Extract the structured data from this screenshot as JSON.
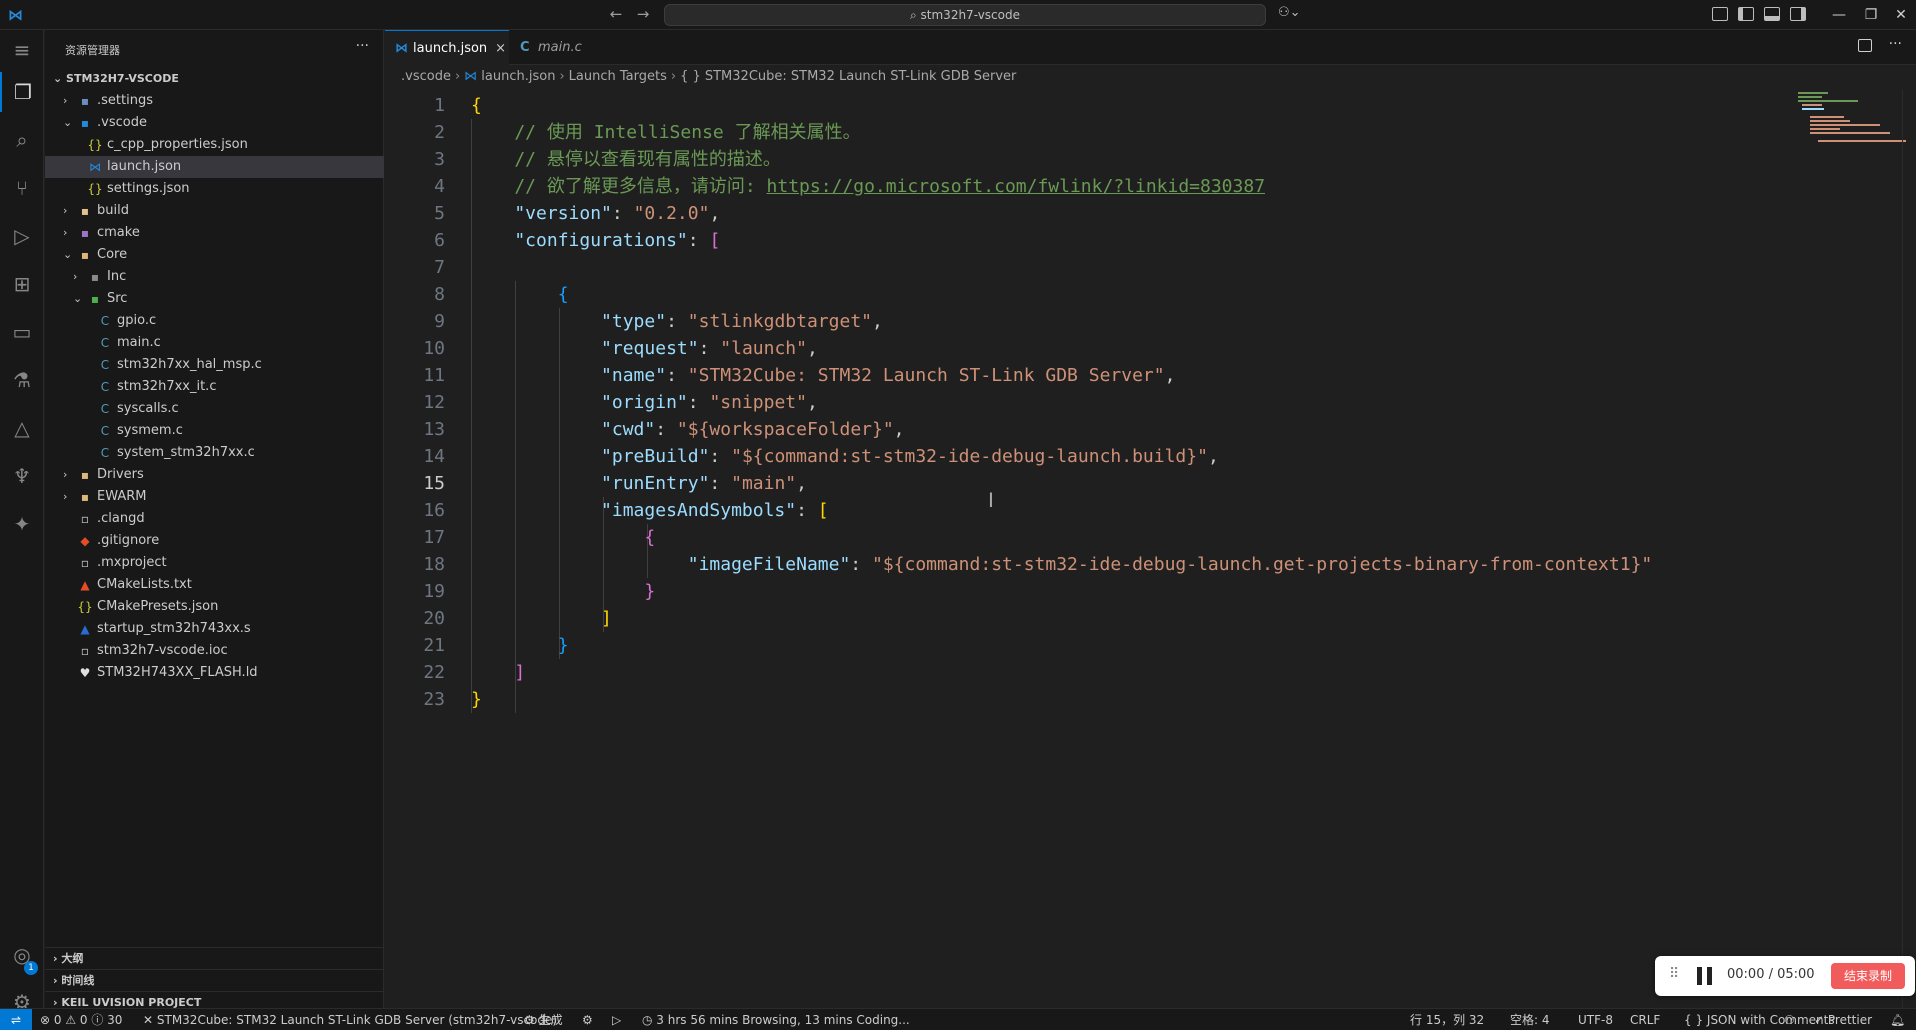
{
  "titlebar": {
    "search_label": "stm32h7-vscode"
  },
  "activity": {
    "account_badge": "1"
  },
  "sidebar": {
    "header": "资源管理器",
    "root": "STM32H7-VSCODE",
    "tree": [
      {
        "label": ".settings",
        "depth": 1,
        "chev": "›",
        "icon": "▪",
        "color": "#6c8ebf"
      },
      {
        "label": ".vscode",
        "depth": 1,
        "chev": "⌄",
        "icon": "▪",
        "color": "#2489db"
      },
      {
        "label": "c_cpp_properties.json",
        "depth": 2,
        "chev": "",
        "icon": "{}",
        "color": "#cbcb41"
      },
      {
        "label": "launch.json",
        "depth": 2,
        "chev": "",
        "icon": "⋈",
        "color": "#2489db",
        "selected": true
      },
      {
        "label": "settings.json",
        "depth": 2,
        "chev": "",
        "icon": "{}",
        "color": "#cbcb41"
      },
      {
        "label": "build",
        "depth": 1,
        "chev": "›",
        "icon": "▪",
        "color": "#e2c08d"
      },
      {
        "label": "cmake",
        "depth": 1,
        "chev": "›",
        "icon": "▪",
        "color": "#a074c4"
      },
      {
        "label": "Core",
        "depth": 1,
        "chev": "⌄",
        "icon": "▪",
        "color": "#dcb67a"
      },
      {
        "label": "Inc",
        "depth": 2,
        "chev": "›",
        "icon": "▪",
        "color": "#8a8a8a"
      },
      {
        "label": "Src",
        "depth": 2,
        "chev": "⌄",
        "icon": "▪",
        "color": "#4caf50"
      },
      {
        "label": "gpio.c",
        "depth": 3,
        "chev": "",
        "icon": "C",
        "color": "#519aba"
      },
      {
        "label": "main.c",
        "depth": 3,
        "chev": "",
        "icon": "C",
        "color": "#519aba"
      },
      {
        "label": "stm32h7xx_hal_msp.c",
        "depth": 3,
        "chev": "",
        "icon": "C",
        "color": "#519aba"
      },
      {
        "label": "stm32h7xx_it.c",
        "depth": 3,
        "chev": "",
        "icon": "C",
        "color": "#519aba"
      },
      {
        "label": "syscalls.c",
        "depth": 3,
        "chev": "",
        "icon": "C",
        "color": "#519aba"
      },
      {
        "label": "sysmem.c",
        "depth": 3,
        "chev": "",
        "icon": "C",
        "color": "#519aba"
      },
      {
        "label": "system_stm32h7xx.c",
        "depth": 3,
        "chev": "",
        "icon": "C",
        "color": "#519aba"
      },
      {
        "label": "Drivers",
        "depth": 1,
        "chev": "›",
        "icon": "▪",
        "color": "#dcb67a"
      },
      {
        "label": "EWARM",
        "depth": 1,
        "chev": "›",
        "icon": "▪",
        "color": "#dcb67a"
      },
      {
        "label": ".clangd",
        "depth": 1,
        "chev": "",
        "icon": "▫",
        "color": "#cccccc"
      },
      {
        "label": ".gitignore",
        "depth": 1,
        "chev": "",
        "icon": "◆",
        "color": "#e54d26"
      },
      {
        "label": ".mxproject",
        "depth": 1,
        "chev": "",
        "icon": "▫",
        "color": "#cccccc"
      },
      {
        "label": "CMakeLists.txt",
        "depth": 1,
        "chev": "",
        "icon": "▲",
        "color": "#e54d26"
      },
      {
        "label": "CMakePresets.json",
        "depth": 1,
        "chev": "",
        "icon": "{}",
        "color": "#cbcb41"
      },
      {
        "label": "startup_stm32h743xx.s",
        "depth": 1,
        "chev": "",
        "icon": "▲",
        "color": "#2a6bd1"
      },
      {
        "label": "stm32h7-vscode.ioc",
        "depth": 1,
        "chev": "",
        "icon": "▫",
        "color": "#cccccc"
      },
      {
        "label": "STM32H743XX_FLASH.ld",
        "depth": 1,
        "chev": "",
        "icon": "♥",
        "color": "#e0e0e0"
      }
    ],
    "bottom": [
      "大纲",
      "时间线",
      "KEIL UVISION PROJECT"
    ]
  },
  "tabs": [
    {
      "label": "launch.json",
      "icon": "⋈",
      "active": true,
      "close": "×"
    },
    {
      "label": "main.c",
      "icon": "C",
      "active": false
    }
  ],
  "breadcrumb": [
    ".vscode",
    "launch.json",
    "Launch Targets",
    "{ } STM32Cube: STM32 Launch ST-Link GDB Server"
  ],
  "code": {
    "current_line": 15,
    "lines": [
      [
        [
          "b1",
          "{"
        ]
      ],
      [
        [
          "cmt",
          "    // 使用 IntelliSense 了解相关属性。"
        ]
      ],
      [
        [
          "cmt",
          "    // 悬停以查看现有属性的描述。"
        ]
      ],
      [
        [
          "cmt",
          "    // 欲了解更多信息，请访问: "
        ],
        [
          "lnk",
          "https://go.microsoft.com/fwlink/?linkid=830387"
        ]
      ],
      [
        [
          "key",
          "    \"version\""
        ],
        [
          "",
          ": "
        ],
        [
          "str",
          "\"0.2.0\""
        ],
        [
          "",
          ","
        ]
      ],
      [
        [
          "key",
          "    \"configurations\""
        ],
        [
          "",
          ": "
        ],
        [
          "b2",
          "["
        ]
      ],
      [
        [
          "",
          ""
        ]
      ],
      [
        [
          "b3",
          "        {"
        ]
      ],
      [
        [
          "key",
          "            \"type\""
        ],
        [
          "",
          ": "
        ],
        [
          "str",
          "\"stlinkgdbtarget\""
        ],
        [
          "",
          ","
        ]
      ],
      [
        [
          "key",
          "            \"request\""
        ],
        [
          "",
          ": "
        ],
        [
          "str",
          "\"launch\""
        ],
        [
          "",
          ","
        ]
      ],
      [
        [
          "key",
          "            \"name\""
        ],
        [
          "",
          ": "
        ],
        [
          "str",
          "\"STM32Cube: STM32 Launch ST-Link GDB Server\""
        ],
        [
          "",
          ","
        ]
      ],
      [
        [
          "key",
          "            \"origin\""
        ],
        [
          "",
          ": "
        ],
        [
          "str",
          "\"snippet\""
        ],
        [
          "",
          ","
        ]
      ],
      [
        [
          "key",
          "            \"cwd\""
        ],
        [
          "",
          ": "
        ],
        [
          "str",
          "\"${workspaceFolder}\""
        ],
        [
          "",
          ","
        ]
      ],
      [
        [
          "key",
          "            \"preBuild\""
        ],
        [
          "",
          ": "
        ],
        [
          "str",
          "\"${command:st-stm32-ide-debug-launch.build}\""
        ],
        [
          "",
          ","
        ]
      ],
      [
        [
          "key",
          "            \"runEntry\""
        ],
        [
          "",
          ": "
        ],
        [
          "str",
          "\"main\""
        ],
        [
          "",
          ","
        ]
      ],
      [
        [
          "key",
          "            \"imagesAndSymbols\""
        ],
        [
          "",
          ": "
        ],
        [
          "b1",
          "["
        ]
      ],
      [
        [
          "b2",
          "                {"
        ]
      ],
      [
        [
          "key",
          "                    \"imageFileName\""
        ],
        [
          "",
          ": "
        ],
        [
          "str",
          "\"${command:st-stm32-ide-debug-launch.get-projects-binary-from-context1}\""
        ]
      ],
      [
        [
          "b2",
          "                }"
        ]
      ],
      [
        [
          "b1",
          "            ]"
        ]
      ],
      [
        [
          "b3",
          "        }"
        ]
      ],
      [
        [
          "b2",
          "    ]"
        ]
      ],
      [
        [
          "b1",
          "}"
        ]
      ]
    ]
  },
  "recording": {
    "time": "00:00 / 05:00",
    "stop_label": "结束录制"
  },
  "statusbar": {
    "problems": "⊗ 0 ⚠ 0 ⓘ 30",
    "launch_target": "✕ STM32Cube: STM32 Launch ST-Link GDB Server (stm32h7-vscode)",
    "build": "⚙ 生成",
    "time_tracking": "◷ 3 hrs 56 mins Browsing, 13 mins Coding...",
    "cursor_pos": "行 15，列 32",
    "spaces": "空格: 4",
    "encoding": "UTF-8",
    "eol": "CRLF",
    "language": "{ } JSON with Comments",
    "prettier": "✓ Prettier"
  }
}
